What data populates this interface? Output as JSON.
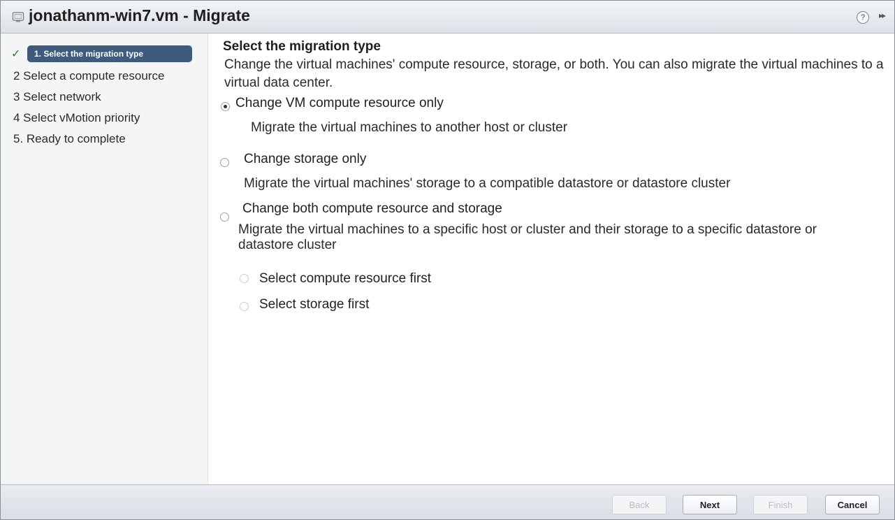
{
  "window": {
    "title": "jonathanm-win7.vm - Migrate",
    "icons": {
      "vm": "vm-icon",
      "help": "help-icon",
      "expand": "expand-icon"
    },
    "help_glyph": "?",
    "expand_glyph": "▸▸"
  },
  "steps": [
    {
      "label": "1. Select the migration type",
      "state": "active"
    },
    {
      "label": "2 Select a compute resource",
      "state": "pending"
    },
    {
      "label": "3 Select network",
      "state": "pending"
    },
    {
      "label": "4 Select vMotion priority",
      "state": "pending"
    },
    {
      "label": "5. Ready to complete",
      "state": "pending"
    }
  ],
  "content": {
    "heading": "Select the migration type",
    "description": "Change the virtual machines' compute resource, storage, or both. You can also migrate the virtual machines to a virtual data center.",
    "options": [
      {
        "label": "Change VM compute resource only",
        "description": "Migrate the virtual machines to another host or cluster",
        "checked": true
      },
      {
        "label": "Change storage only",
        "description": "Migrate the virtual machines' storage to a compatible datastore or datastore cluster",
        "checked": false
      },
      {
        "label": "Change both compute resource and storage",
        "description": "Migrate the virtual machines to a specific host or cluster and their storage to a specific datastore or datastore cluster",
        "checked": false
      }
    ],
    "sub_options": [
      {
        "label": "Select compute resource first",
        "checked": false,
        "enabled": false
      },
      {
        "label": "Select storage first",
        "checked": false,
        "enabled": false
      }
    ]
  },
  "footer": {
    "back_label": "Back",
    "next_label": "Next",
    "finish_label": "Finish",
    "cancel_label": "Cancel"
  },
  "colors": {
    "active_step": "#3e5a7d",
    "titlebar": "#dde2e8",
    "footer": "#d9dee4"
  }
}
